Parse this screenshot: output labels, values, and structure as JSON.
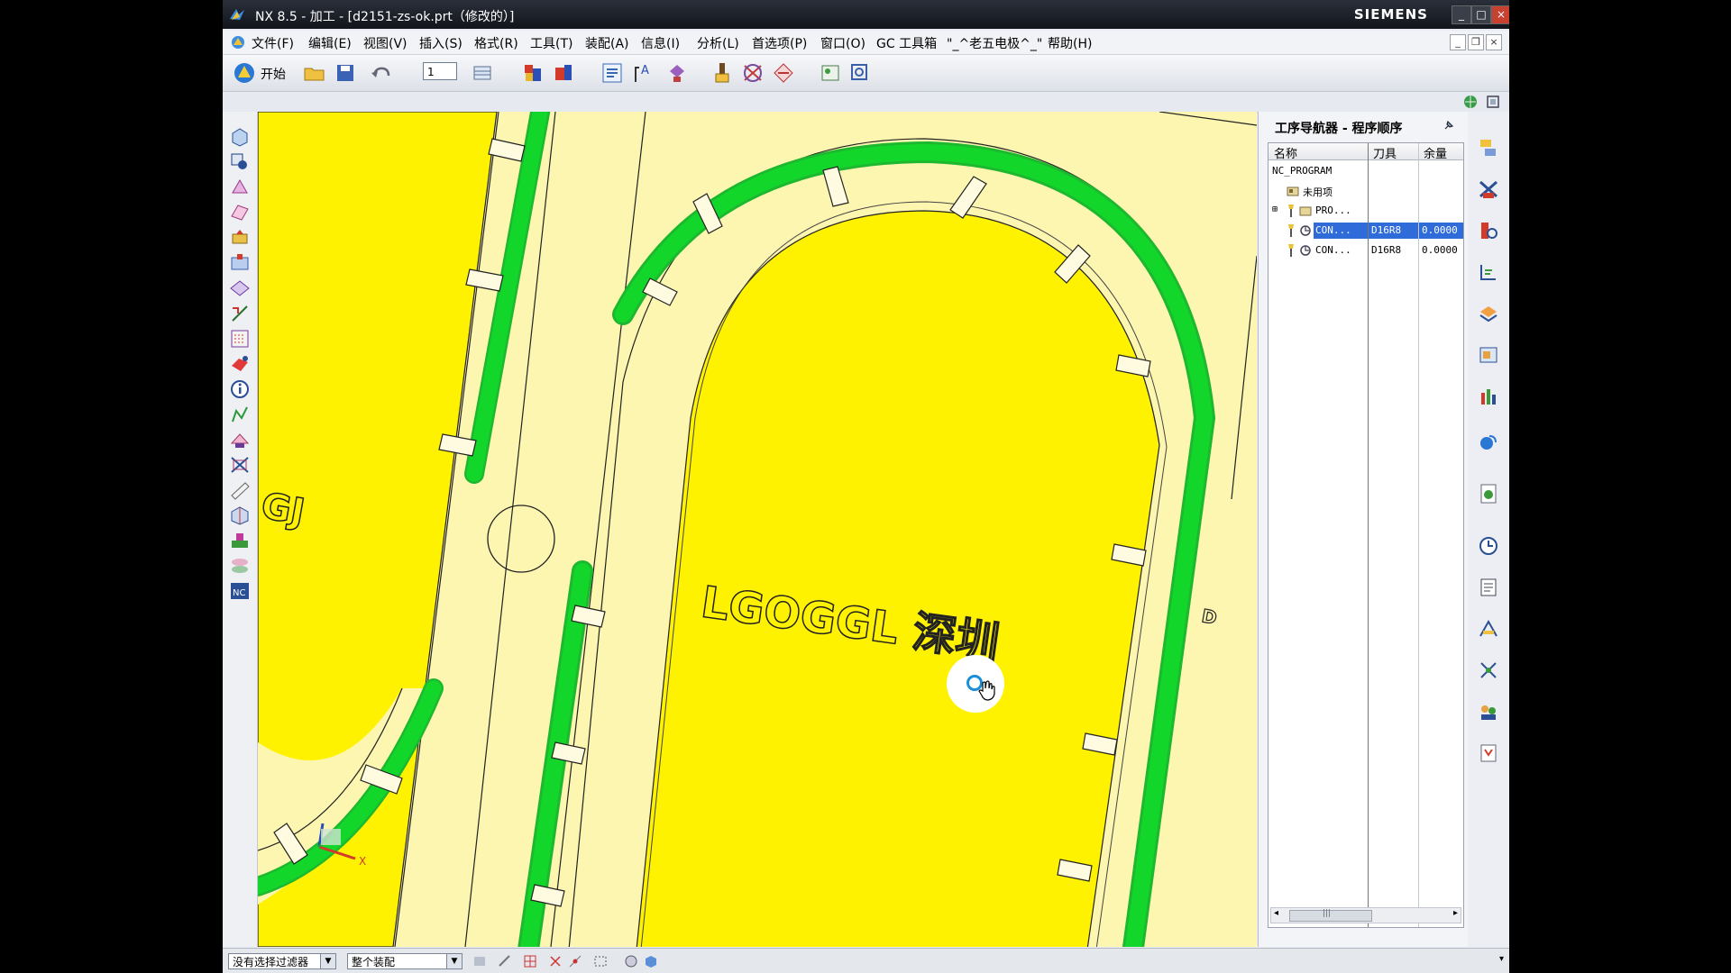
{
  "window": {
    "title": "NX 8.5 - 加工 - [d2151-zs-ok.prt（修改的）]",
    "brand": "SIEMENS",
    "minimize": "_",
    "maximize": "□",
    "close": "×"
  },
  "menu": {
    "items": [
      "文件(F)",
      "编辑(E)",
      "视图(V)",
      "插入(S)",
      "格式(R)",
      "工具(T)",
      "装配(A)",
      "信息(I)",
      "分析(L)",
      "首选项(P)",
      "窗口(O)",
      "GC 工具箱",
      "\"_^老五电极^_\"",
      "帮助(H)"
    ]
  },
  "toolbar": {
    "start_label": "开始",
    "layer_value": "1"
  },
  "navigator": {
    "title": "工序导航器 - 程序顺序",
    "columns": [
      "名称",
      "刀具",
      "余量"
    ],
    "rows": [
      {
        "name": "NC_PROGRAM",
        "tool": "",
        "stock": ""
      },
      {
        "name": "未用项",
        "tool": "",
        "stock": ""
      },
      {
        "name": "PRO...",
        "tool": "",
        "stock": ""
      },
      {
        "name": "CON...",
        "tool": "D16R8",
        "stock": "0.0000",
        "selected": true
      },
      {
        "name": "CON...",
        "tool": "D16R8",
        "stock": "0.0000"
      }
    ],
    "scroll_thumb": "|||"
  },
  "viewport": {
    "engraved_text": "LGOGGL 深圳",
    "side_text_left": "GJ",
    "side_text_right": "D",
    "axis_label": "X"
  },
  "statusbar": {
    "filter_value": "没有选择过滤器",
    "scope_value": "整个装配"
  },
  "colors": {
    "part_yellow": "#fff200",
    "background_yellow": "#fdf6b0",
    "toolpath_green": "#13d62a",
    "selection_blue": "#2f6bd9"
  }
}
